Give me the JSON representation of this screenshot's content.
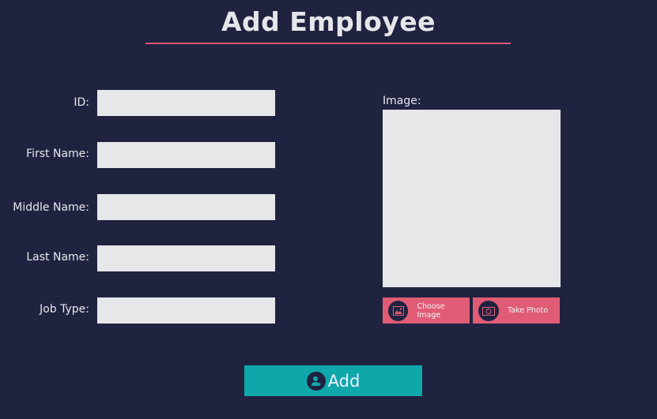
{
  "title": "Add Employee",
  "form": {
    "fields": [
      {
        "label": "ID:",
        "value": ""
      },
      {
        "label": "First Name:",
        "value": ""
      },
      {
        "label": "Middle Name:",
        "value": ""
      },
      {
        "label": "Last Name:",
        "value": ""
      },
      {
        "label": "Job Type:",
        "value": ""
      }
    ]
  },
  "image": {
    "label": "Image:",
    "choose_label": "Choose Image",
    "take_label": "Take Photo"
  },
  "add_label": "Add",
  "colors": {
    "background": "#1f2340",
    "accent": "#e05c75",
    "primary": "#10a7aa"
  }
}
